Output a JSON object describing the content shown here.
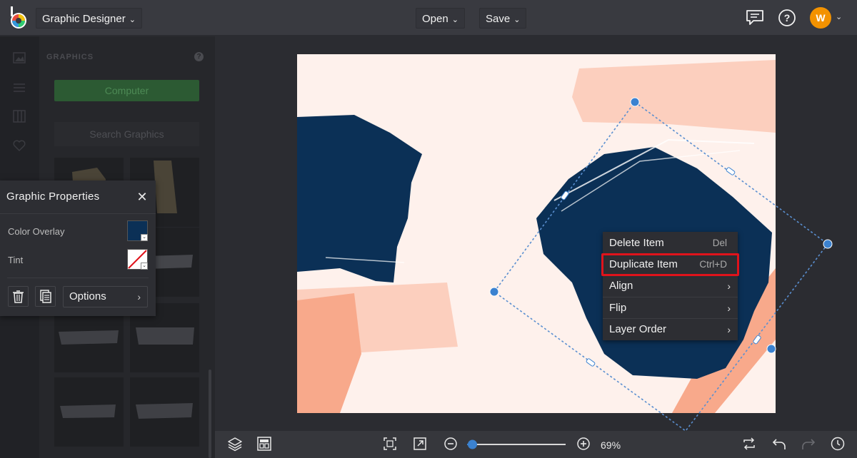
{
  "app": {
    "name": "Graphic Designer"
  },
  "topbar": {
    "app_menu_label": "Graphic Designer",
    "open_label": "Open",
    "save_label": "Save",
    "chevron": "⌄",
    "user_initial": "W",
    "icons": [
      "comment-icon",
      "help-icon",
      "user-avatar"
    ]
  },
  "panel": {
    "title": "GRAPHICS",
    "help": "?",
    "computer_button": "Computer",
    "search_placeholder": "Search Graphics"
  },
  "graphic_properties": {
    "title": "Graphic Properties",
    "close": "✕",
    "color_overlay_label": "Color Overlay",
    "color_overlay_value": "#0b3056",
    "tint_label": "Tint",
    "options_label": "Options",
    "options_arrow": "›"
  },
  "context_menu": {
    "items": [
      {
        "label": "Delete Item",
        "shortcut": "Del"
      },
      {
        "label": "Duplicate Item",
        "shortcut": "Ctrl+D"
      },
      {
        "label": "Align",
        "arrow": "›"
      },
      {
        "label": "Flip",
        "arrow": "›"
      },
      {
        "label": "Layer Order",
        "arrow": "›"
      }
    ]
  },
  "bottombar": {
    "zoom_percent": 69,
    "zoom_label": "69%",
    "icons": [
      "layers-icon",
      "layout-icon",
      "fit-screen-icon",
      "expand-icon",
      "zoom-out-icon",
      "zoom-in-icon",
      "swap-icon",
      "undo-icon",
      "redo-icon",
      "history-icon"
    ]
  },
  "colors": {
    "accent_green": "#2c5a33",
    "navy": "#0b3056",
    "peach": "#f7a98b",
    "canvas_bg": "#fef1ec",
    "highlight_red": "#e0131b",
    "selection_blue": "#3b82d0",
    "avatar_orange": "#f39200"
  }
}
